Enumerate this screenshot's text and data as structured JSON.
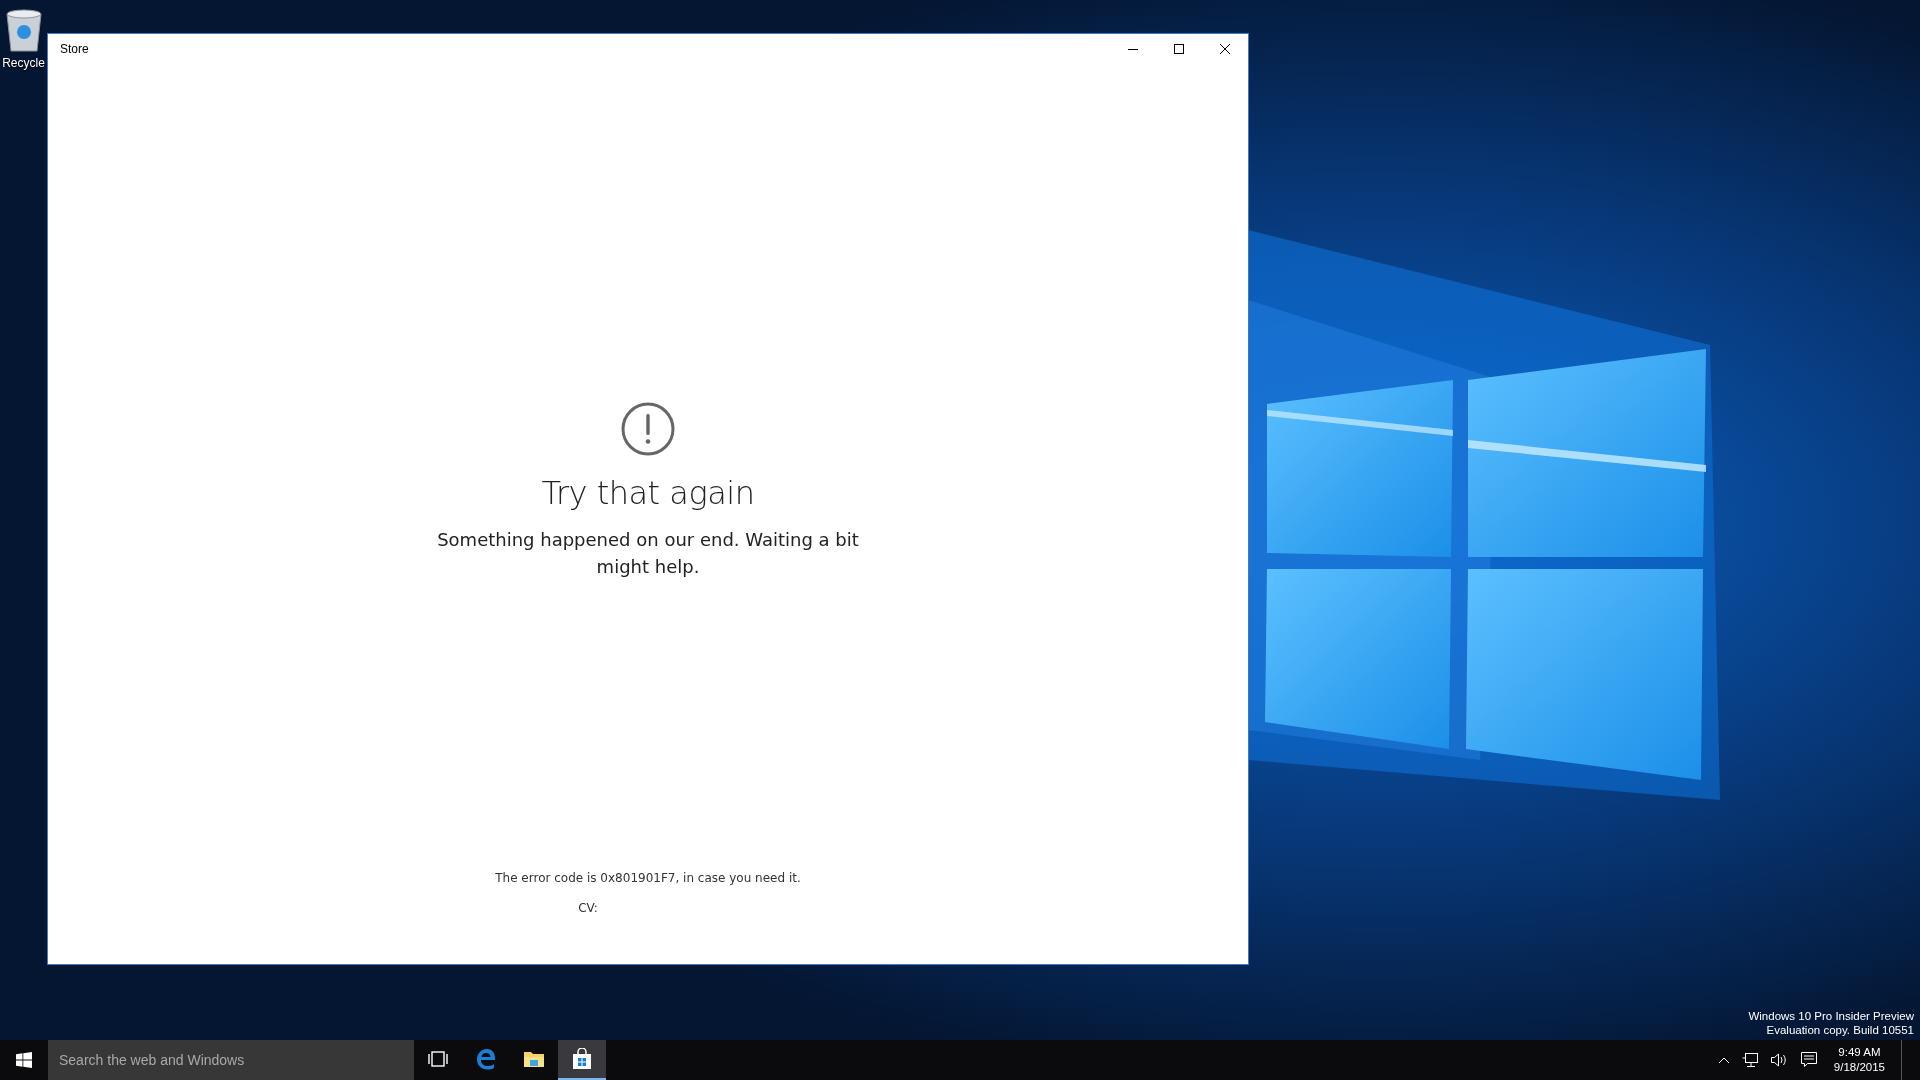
{
  "desktop": {
    "icons": [
      {
        "label": "Recycle"
      }
    ],
    "build_info": [
      "Windows 10 Pro Insider Preview",
      "Evaluation copy. Build 10551"
    ]
  },
  "window": {
    "title": "Store",
    "error": {
      "heading": "Try that again",
      "message": "Something happened on our end. Waiting a bit might help.",
      "code_text": "The error code is 0x801901F7, in case you need it.",
      "cv_label": "CV:"
    }
  },
  "taskbar": {
    "search": {
      "placeholder": "Search the web and Windows"
    },
    "apps": [
      {
        "kind": "task-view",
        "selected": false
      },
      {
        "kind": "edge",
        "selected": false
      },
      {
        "kind": "explorer",
        "selected": false
      },
      {
        "kind": "store",
        "selected": true
      }
    ],
    "clock": {
      "time": "9:49 AM",
      "date": "9/18/2015"
    }
  }
}
